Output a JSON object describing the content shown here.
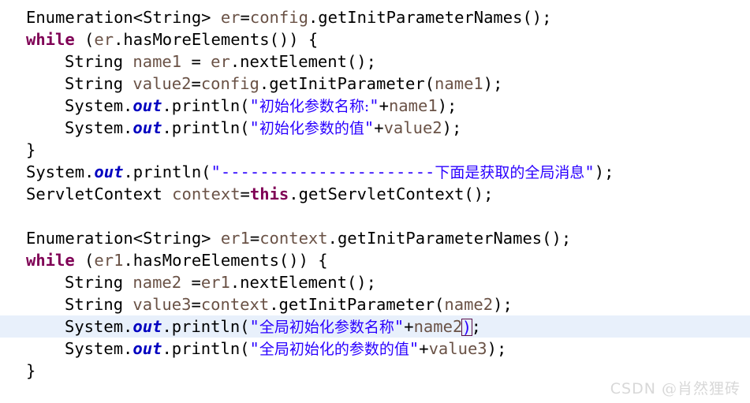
{
  "editor": {
    "language": "java",
    "background_color": "#ffffff",
    "highlight_line_color": "#e8f0fb",
    "colors": {
      "keyword": "#7f0055",
      "static_field": "#0000c0",
      "local_variable": "#6a5246",
      "string": "#2a00ff",
      "plain_text": "#000000",
      "bracket_match_border": "#5c0f4a"
    },
    "lines": [
      {
        "number": 1,
        "indent": 0,
        "highlighted": false,
        "tokens": [
          {
            "t": "plain",
            "v": "Enumeration<String> "
          },
          {
            "t": "var",
            "v": "er"
          },
          {
            "t": "plain",
            "v": "="
          },
          {
            "t": "var",
            "v": "config"
          },
          {
            "t": "plain",
            "v": ".getInitParameterNames();"
          }
        ]
      },
      {
        "number": 2,
        "indent": 0,
        "highlighted": false,
        "tokens": [
          {
            "t": "kw",
            "v": "while"
          },
          {
            "t": "plain",
            "v": " ("
          },
          {
            "t": "var",
            "v": "er"
          },
          {
            "t": "plain",
            "v": ".hasMoreElements()) {"
          }
        ]
      },
      {
        "number": 3,
        "indent": 1,
        "highlighted": false,
        "tokens": [
          {
            "t": "plain",
            "v": "String "
          },
          {
            "t": "var",
            "v": "name1"
          },
          {
            "t": "plain",
            "v": " = "
          },
          {
            "t": "var",
            "v": "er"
          },
          {
            "t": "plain",
            "v": ".nextElement();"
          }
        ]
      },
      {
        "number": 4,
        "indent": 1,
        "highlighted": false,
        "tokens": [
          {
            "t": "plain",
            "v": "String "
          },
          {
            "t": "var",
            "v": "value2"
          },
          {
            "t": "plain",
            "v": "="
          },
          {
            "t": "var",
            "v": "config"
          },
          {
            "t": "plain",
            "v": ".getInitParameter("
          },
          {
            "t": "var",
            "v": "name1"
          },
          {
            "t": "plain",
            "v": ");"
          }
        ]
      },
      {
        "number": 5,
        "indent": 1,
        "highlighted": false,
        "tokens": [
          {
            "t": "plain",
            "v": "System."
          },
          {
            "t": "field",
            "v": "out"
          },
          {
            "t": "plain",
            "v": ".println("
          },
          {
            "t": "str",
            "v": "\""
          },
          {
            "t": "str-cjk",
            "v": "初始化参数名称:"
          },
          {
            "t": "str",
            "v": "\""
          },
          {
            "t": "plain",
            "v": "+"
          },
          {
            "t": "var",
            "v": "name1"
          },
          {
            "t": "plain",
            "v": ");"
          }
        ]
      },
      {
        "number": 6,
        "indent": 1,
        "highlighted": false,
        "tokens": [
          {
            "t": "plain",
            "v": "System."
          },
          {
            "t": "field",
            "v": "out"
          },
          {
            "t": "plain",
            "v": ".println("
          },
          {
            "t": "str",
            "v": "\""
          },
          {
            "t": "str-cjk",
            "v": "初始化参数的值"
          },
          {
            "t": "str",
            "v": "\""
          },
          {
            "t": "plain",
            "v": "+"
          },
          {
            "t": "var",
            "v": "value2"
          },
          {
            "t": "plain",
            "v": ");"
          }
        ]
      },
      {
        "number": 7,
        "indent": 0,
        "highlighted": false,
        "tokens": [
          {
            "t": "plain",
            "v": "}"
          }
        ]
      },
      {
        "number": 8,
        "indent": 0,
        "highlighted": false,
        "tokens": [
          {
            "t": "plain",
            "v": "System."
          },
          {
            "t": "field",
            "v": "out"
          },
          {
            "t": "plain",
            "v": ".println("
          },
          {
            "t": "str",
            "v": "\"----------------------"
          },
          {
            "t": "str-cjk",
            "v": "下面是获取的全局消息"
          },
          {
            "t": "str",
            "v": "\""
          },
          {
            "t": "plain",
            "v": ");"
          }
        ]
      },
      {
        "number": 9,
        "indent": 0,
        "highlighted": false,
        "tokens": [
          {
            "t": "plain",
            "v": "ServletContext "
          },
          {
            "t": "var",
            "v": "context"
          },
          {
            "t": "plain",
            "v": "="
          },
          {
            "t": "kw",
            "v": "this"
          },
          {
            "t": "plain",
            "v": ".getServletContext();"
          }
        ]
      },
      {
        "number": 10,
        "indent": 0,
        "highlighted": false,
        "tokens": []
      },
      {
        "number": 11,
        "indent": 0,
        "highlighted": false,
        "tokens": [
          {
            "t": "plain",
            "v": "Enumeration<String> "
          },
          {
            "t": "var",
            "v": "er1"
          },
          {
            "t": "plain",
            "v": "="
          },
          {
            "t": "var",
            "v": "context"
          },
          {
            "t": "plain",
            "v": ".getInitParameterNames();"
          }
        ]
      },
      {
        "number": 12,
        "indent": 0,
        "highlighted": false,
        "tokens": [
          {
            "t": "kw",
            "v": "while"
          },
          {
            "t": "plain",
            "v": " ("
          },
          {
            "t": "var",
            "v": "er1"
          },
          {
            "t": "plain",
            "v": ".hasMoreElements()) {"
          }
        ]
      },
      {
        "number": 13,
        "indent": 1,
        "highlighted": false,
        "tokens": [
          {
            "t": "plain",
            "v": "String "
          },
          {
            "t": "var",
            "v": "name2"
          },
          {
            "t": "plain",
            "v": " ="
          },
          {
            "t": "var",
            "v": "er1"
          },
          {
            "t": "plain",
            "v": ".nextElement();"
          }
        ]
      },
      {
        "number": 14,
        "indent": 1,
        "highlighted": false,
        "tokens": [
          {
            "t": "plain",
            "v": "String "
          },
          {
            "t": "var",
            "v": "value3"
          },
          {
            "t": "plain",
            "v": "="
          },
          {
            "t": "var",
            "v": "context"
          },
          {
            "t": "plain",
            "v": ".getInitParameter("
          },
          {
            "t": "var",
            "v": "name2"
          },
          {
            "t": "plain",
            "v": ");"
          }
        ]
      },
      {
        "number": 15,
        "indent": 1,
        "highlighted": true,
        "tokens": [
          {
            "t": "plain",
            "v": "System."
          },
          {
            "t": "field",
            "v": "out"
          },
          {
            "t": "plain",
            "v": ".println("
          },
          {
            "t": "str",
            "v": "\""
          },
          {
            "t": "str-cjk",
            "v": "全局初始化参数名称"
          },
          {
            "t": "str",
            "v": "\""
          },
          {
            "t": "plain",
            "v": "+"
          },
          {
            "t": "var",
            "v": "name2"
          },
          {
            "t": "bracket-match",
            "v": ")"
          },
          {
            "t": "plain",
            "v": ";"
          }
        ]
      },
      {
        "number": 16,
        "indent": 1,
        "highlighted": false,
        "tokens": [
          {
            "t": "plain",
            "v": "System."
          },
          {
            "t": "field",
            "v": "out"
          },
          {
            "t": "plain",
            "v": ".println("
          },
          {
            "t": "str",
            "v": "\""
          },
          {
            "t": "str-cjk",
            "v": "全局初始化的参数的值"
          },
          {
            "t": "str",
            "v": "\""
          },
          {
            "t": "plain",
            "v": "+"
          },
          {
            "t": "var",
            "v": "value3"
          },
          {
            "t": "plain",
            "v": ");"
          }
        ]
      },
      {
        "number": 17,
        "indent": 0,
        "highlighted": false,
        "tokens": [
          {
            "t": "plain",
            "v": "}"
          }
        ]
      }
    ]
  },
  "watermark": {
    "prefix": "CSDN ",
    "handle": "@肖然狸砖"
  }
}
